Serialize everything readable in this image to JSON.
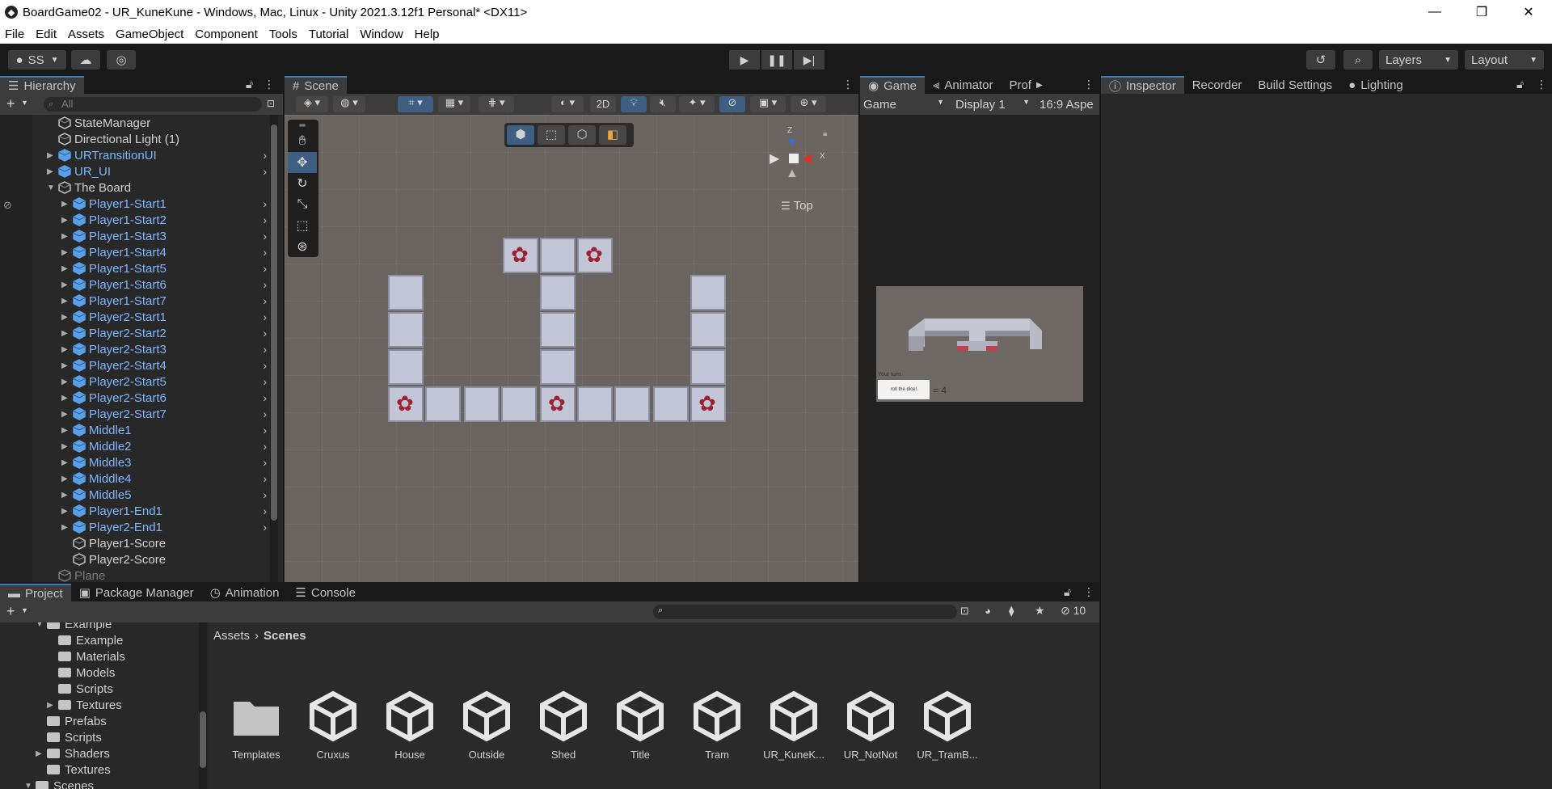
{
  "window": {
    "title": "BoardGame02 - UR_KuneKune - Windows, Mac, Linux - Unity 2021.3.12f1 Personal* <DX11>",
    "minimize": "—",
    "restore": "❐",
    "close": "✕"
  },
  "menu": [
    "File",
    "Edit",
    "Assets",
    "GameObject",
    "Component",
    "Tools",
    "Tutorial",
    "Window",
    "Help"
  ],
  "toolbar": {
    "account": "SS",
    "layers": "Layers",
    "layout": "Layout"
  },
  "hierarchy": {
    "tab": "Hierarchy",
    "search_placeholder": "All",
    "items": [
      {
        "label": "StateManager",
        "style": "plain",
        "indent": 1,
        "arrow": false,
        "expand": ""
      },
      {
        "label": "Directional Light (1)",
        "style": "plain",
        "indent": 1,
        "arrow": false,
        "expand": ""
      },
      {
        "label": "URTransitionUI",
        "style": "blue",
        "indent": 1,
        "arrow": true,
        "expand": "▶"
      },
      {
        "label": "UR_UI",
        "style": "blue",
        "indent": 1,
        "arrow": true,
        "expand": "▶"
      },
      {
        "label": "The Board",
        "style": "plain",
        "indent": 1,
        "arrow": false,
        "expand": "▼"
      },
      {
        "label": "Player1-Start1",
        "style": "blue",
        "indent": 2,
        "arrow": true,
        "expand": "▶"
      },
      {
        "label": "Player1-Start2",
        "style": "blue",
        "indent": 2,
        "arrow": true,
        "expand": "▶"
      },
      {
        "label": "Player1-Start3",
        "style": "blue",
        "indent": 2,
        "arrow": true,
        "expand": "▶"
      },
      {
        "label": "Player1-Start4",
        "style": "blue",
        "indent": 2,
        "arrow": true,
        "expand": "▶"
      },
      {
        "label": "Player1-Start5",
        "style": "blue",
        "indent": 2,
        "arrow": true,
        "expand": "▶"
      },
      {
        "label": "Player1-Start6",
        "style": "blue",
        "indent": 2,
        "arrow": true,
        "expand": "▶"
      },
      {
        "label": "Player1-Start7",
        "style": "blue",
        "indent": 2,
        "arrow": true,
        "expand": "▶"
      },
      {
        "label": "Player2-Start1",
        "style": "blue",
        "indent": 2,
        "arrow": true,
        "expand": "▶"
      },
      {
        "label": "Player2-Start2",
        "style": "blue",
        "indent": 2,
        "arrow": true,
        "expand": "▶"
      },
      {
        "label": "Player2-Start3",
        "style": "blue",
        "indent": 2,
        "arrow": true,
        "expand": "▶"
      },
      {
        "label": "Player2-Start4",
        "style": "blue",
        "indent": 2,
        "arrow": true,
        "expand": "▶"
      },
      {
        "label": "Player2-Start5",
        "style": "blue",
        "indent": 2,
        "arrow": true,
        "expand": "▶"
      },
      {
        "label": "Player2-Start6",
        "style": "blue",
        "indent": 2,
        "arrow": true,
        "expand": "▶"
      },
      {
        "label": "Player2-Start7",
        "style": "blue",
        "indent": 2,
        "arrow": true,
        "expand": "▶"
      },
      {
        "label": "Middle1",
        "style": "blue",
        "indent": 2,
        "arrow": true,
        "expand": "▶"
      },
      {
        "label": "Middle2",
        "style": "blue",
        "indent": 2,
        "arrow": true,
        "expand": "▶"
      },
      {
        "label": "Middle3",
        "style": "blue",
        "indent": 2,
        "arrow": true,
        "expand": "▶"
      },
      {
        "label": "Middle4",
        "style": "blue",
        "indent": 2,
        "arrow": true,
        "expand": "▶"
      },
      {
        "label": "Middle5",
        "style": "blue",
        "indent": 2,
        "arrow": true,
        "expand": "▶"
      },
      {
        "label": "Player1-End1",
        "style": "blue",
        "indent": 2,
        "arrow": true,
        "expand": "▶"
      },
      {
        "label": "Player2-End1",
        "style": "blue",
        "indent": 2,
        "arrow": true,
        "expand": "▶"
      },
      {
        "label": "Player1-Score",
        "style": "plain",
        "indent": 2,
        "arrow": false,
        "expand": ""
      },
      {
        "label": "Player2-Score",
        "style": "plain",
        "indent": 2,
        "arrow": false,
        "expand": ""
      },
      {
        "label": "Plane",
        "style": "dim",
        "indent": 1,
        "arrow": false,
        "expand": ""
      }
    ]
  },
  "scene": {
    "tab": "Scene",
    "mode_2d": "2D",
    "orientation": "Top",
    "gizmo_axes": {
      "y": "Z",
      "x": "X"
    }
  },
  "game": {
    "tabs": [
      "Game",
      "Animator",
      "Prof"
    ],
    "view_select": "Game",
    "display_select": "Display 1",
    "aspect_select": "16:9 Aspe",
    "preview_button": "roll the dice!",
    "preview_label": "Your turn",
    "preview_result": "= 4"
  },
  "inspector": {
    "tabs": [
      "Inspector",
      "Recorder",
      "Build Settings",
      "Lighting"
    ]
  },
  "project": {
    "tabs": [
      "Project",
      "Package Manager",
      "Animation",
      "Console"
    ],
    "hidden_count": "10",
    "breadcrumb": [
      "Assets",
      "Scenes"
    ],
    "tree": [
      {
        "label": "Example",
        "indent": 3,
        "expand": "▼",
        "clip": true
      },
      {
        "label": "Example",
        "indent": 4,
        "expand": ""
      },
      {
        "label": "Materials",
        "indent": 4,
        "expand": ""
      },
      {
        "label": "Models",
        "indent": 4,
        "expand": ""
      },
      {
        "label": "Scripts",
        "indent": 4,
        "expand": ""
      },
      {
        "label": "Textures",
        "indent": 4,
        "expand": "▶"
      },
      {
        "label": "Prefabs",
        "indent": 3,
        "expand": ""
      },
      {
        "label": "Scripts",
        "indent": 3,
        "expand": ""
      },
      {
        "label": "Shaders",
        "indent": 3,
        "expand": "▶"
      },
      {
        "label": "Textures",
        "indent": 3,
        "expand": ""
      },
      {
        "label": "Scenes",
        "indent": 2,
        "expand": "▼"
      }
    ],
    "assets": [
      {
        "label": "Templates",
        "kind": "folder"
      },
      {
        "label": "Cruxus",
        "kind": "scene"
      },
      {
        "label": "House",
        "kind": "scene"
      },
      {
        "label": "Outside",
        "kind": "scene"
      },
      {
        "label": "Shed",
        "kind": "scene"
      },
      {
        "label": "Title",
        "kind": "scene"
      },
      {
        "label": "Tram",
        "kind": "scene"
      },
      {
        "label": "UR_KuneK...",
        "kind": "scene"
      },
      {
        "label": "UR_NotNot",
        "kind": "scene"
      },
      {
        "label": "UR_TramB...",
        "kind": "scene"
      }
    ]
  }
}
